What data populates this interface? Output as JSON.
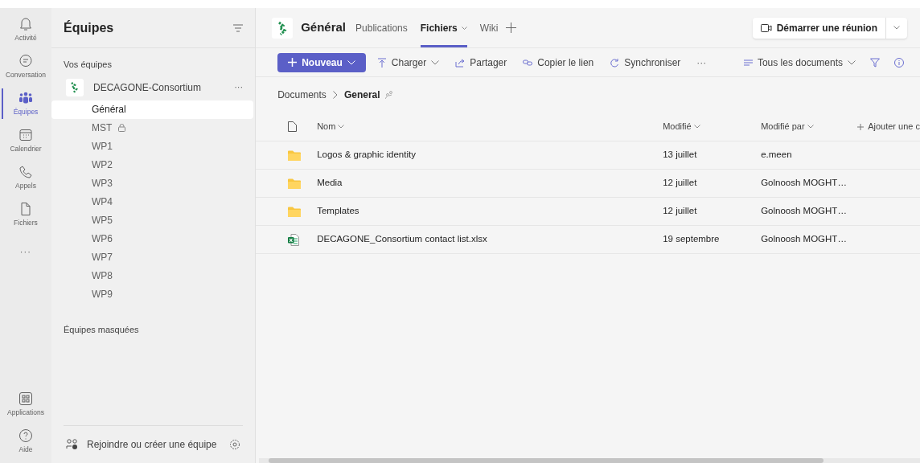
{
  "rail": [
    {
      "label": "Activité",
      "selected": false
    },
    {
      "label": "Conversation",
      "selected": false
    },
    {
      "label": "Équipes",
      "selected": true
    },
    {
      "label": "Calendrier",
      "selected": false
    },
    {
      "label": "Appels",
      "selected": false
    },
    {
      "label": "Fichiers",
      "selected": false
    },
    {
      "label": "···",
      "selected": false
    }
  ],
  "rail_bottom": [
    {
      "label": "Applications",
      "selected": false
    },
    {
      "label": "Aide",
      "selected": false
    }
  ],
  "teams_panel": {
    "title": "Équipes",
    "section": "Vos équipes",
    "team": {
      "name": "DECAGONE-Consortium",
      "more": "···",
      "channels": [
        {
          "name": "Général",
          "selected": true,
          "locked": false
        },
        {
          "name": "MST",
          "selected": false,
          "locked": true
        },
        {
          "name": "WP1",
          "selected": false,
          "locked": false
        },
        {
          "name": "WP2",
          "selected": false,
          "locked": false
        },
        {
          "name": "WP3",
          "selected": false,
          "locked": false
        },
        {
          "name": "WP4",
          "selected": false,
          "locked": false
        },
        {
          "name": "WP5",
          "selected": false,
          "locked": false
        },
        {
          "name": "WP6",
          "selected": false,
          "locked": false
        },
        {
          "name": "WP7",
          "selected": false,
          "locked": false
        },
        {
          "name": "WP8",
          "selected": false,
          "locked": false
        },
        {
          "name": "WP9",
          "selected": false,
          "locked": false
        }
      ]
    },
    "hidden_section": "Équipes masquées",
    "join": "Rejoindre ou créer une équipe"
  },
  "header": {
    "channel": "Général",
    "tabs": [
      {
        "label": "Publications",
        "selected": false,
        "dropdown": false
      },
      {
        "label": "Fichiers",
        "selected": true,
        "dropdown": true
      },
      {
        "label": "Wiki",
        "selected": false,
        "dropdown": false
      }
    ],
    "meeting_button": "Démarrer une réunion"
  },
  "toolbar": {
    "new_button": "Nouveau",
    "actions": [
      {
        "label": "Charger",
        "dropdown": true
      },
      {
        "label": "Partager",
        "dropdown": false
      },
      {
        "label": "Copier le lien",
        "dropdown": false
      },
      {
        "label": "Synchroniser",
        "dropdown": false
      }
    ],
    "more": "···",
    "view": "Tous les documents"
  },
  "breadcrumb": {
    "parent": "Documents",
    "current": "General"
  },
  "table": {
    "columns": [
      "Nom",
      "Modifié",
      "Modifié par",
      "Ajouter une c"
    ],
    "rows": [
      {
        "kind": "folder",
        "name": "Logos & graphic identity",
        "modified": "13 juillet",
        "modified_by": "e.meen"
      },
      {
        "kind": "folder",
        "name": "Media",
        "modified": "12 juillet",
        "modified_by": "Golnoosh MOGHT…"
      },
      {
        "kind": "folder",
        "name": "Templates",
        "modified": "12 juillet",
        "modified_by": "Golnoosh MOGHT…"
      },
      {
        "kind": "excel",
        "name": "DECAGONE_Consortium contact list.xlsx",
        "modified": "19 septembre",
        "modified_by": "Golnoosh MOGHT…"
      }
    ]
  }
}
